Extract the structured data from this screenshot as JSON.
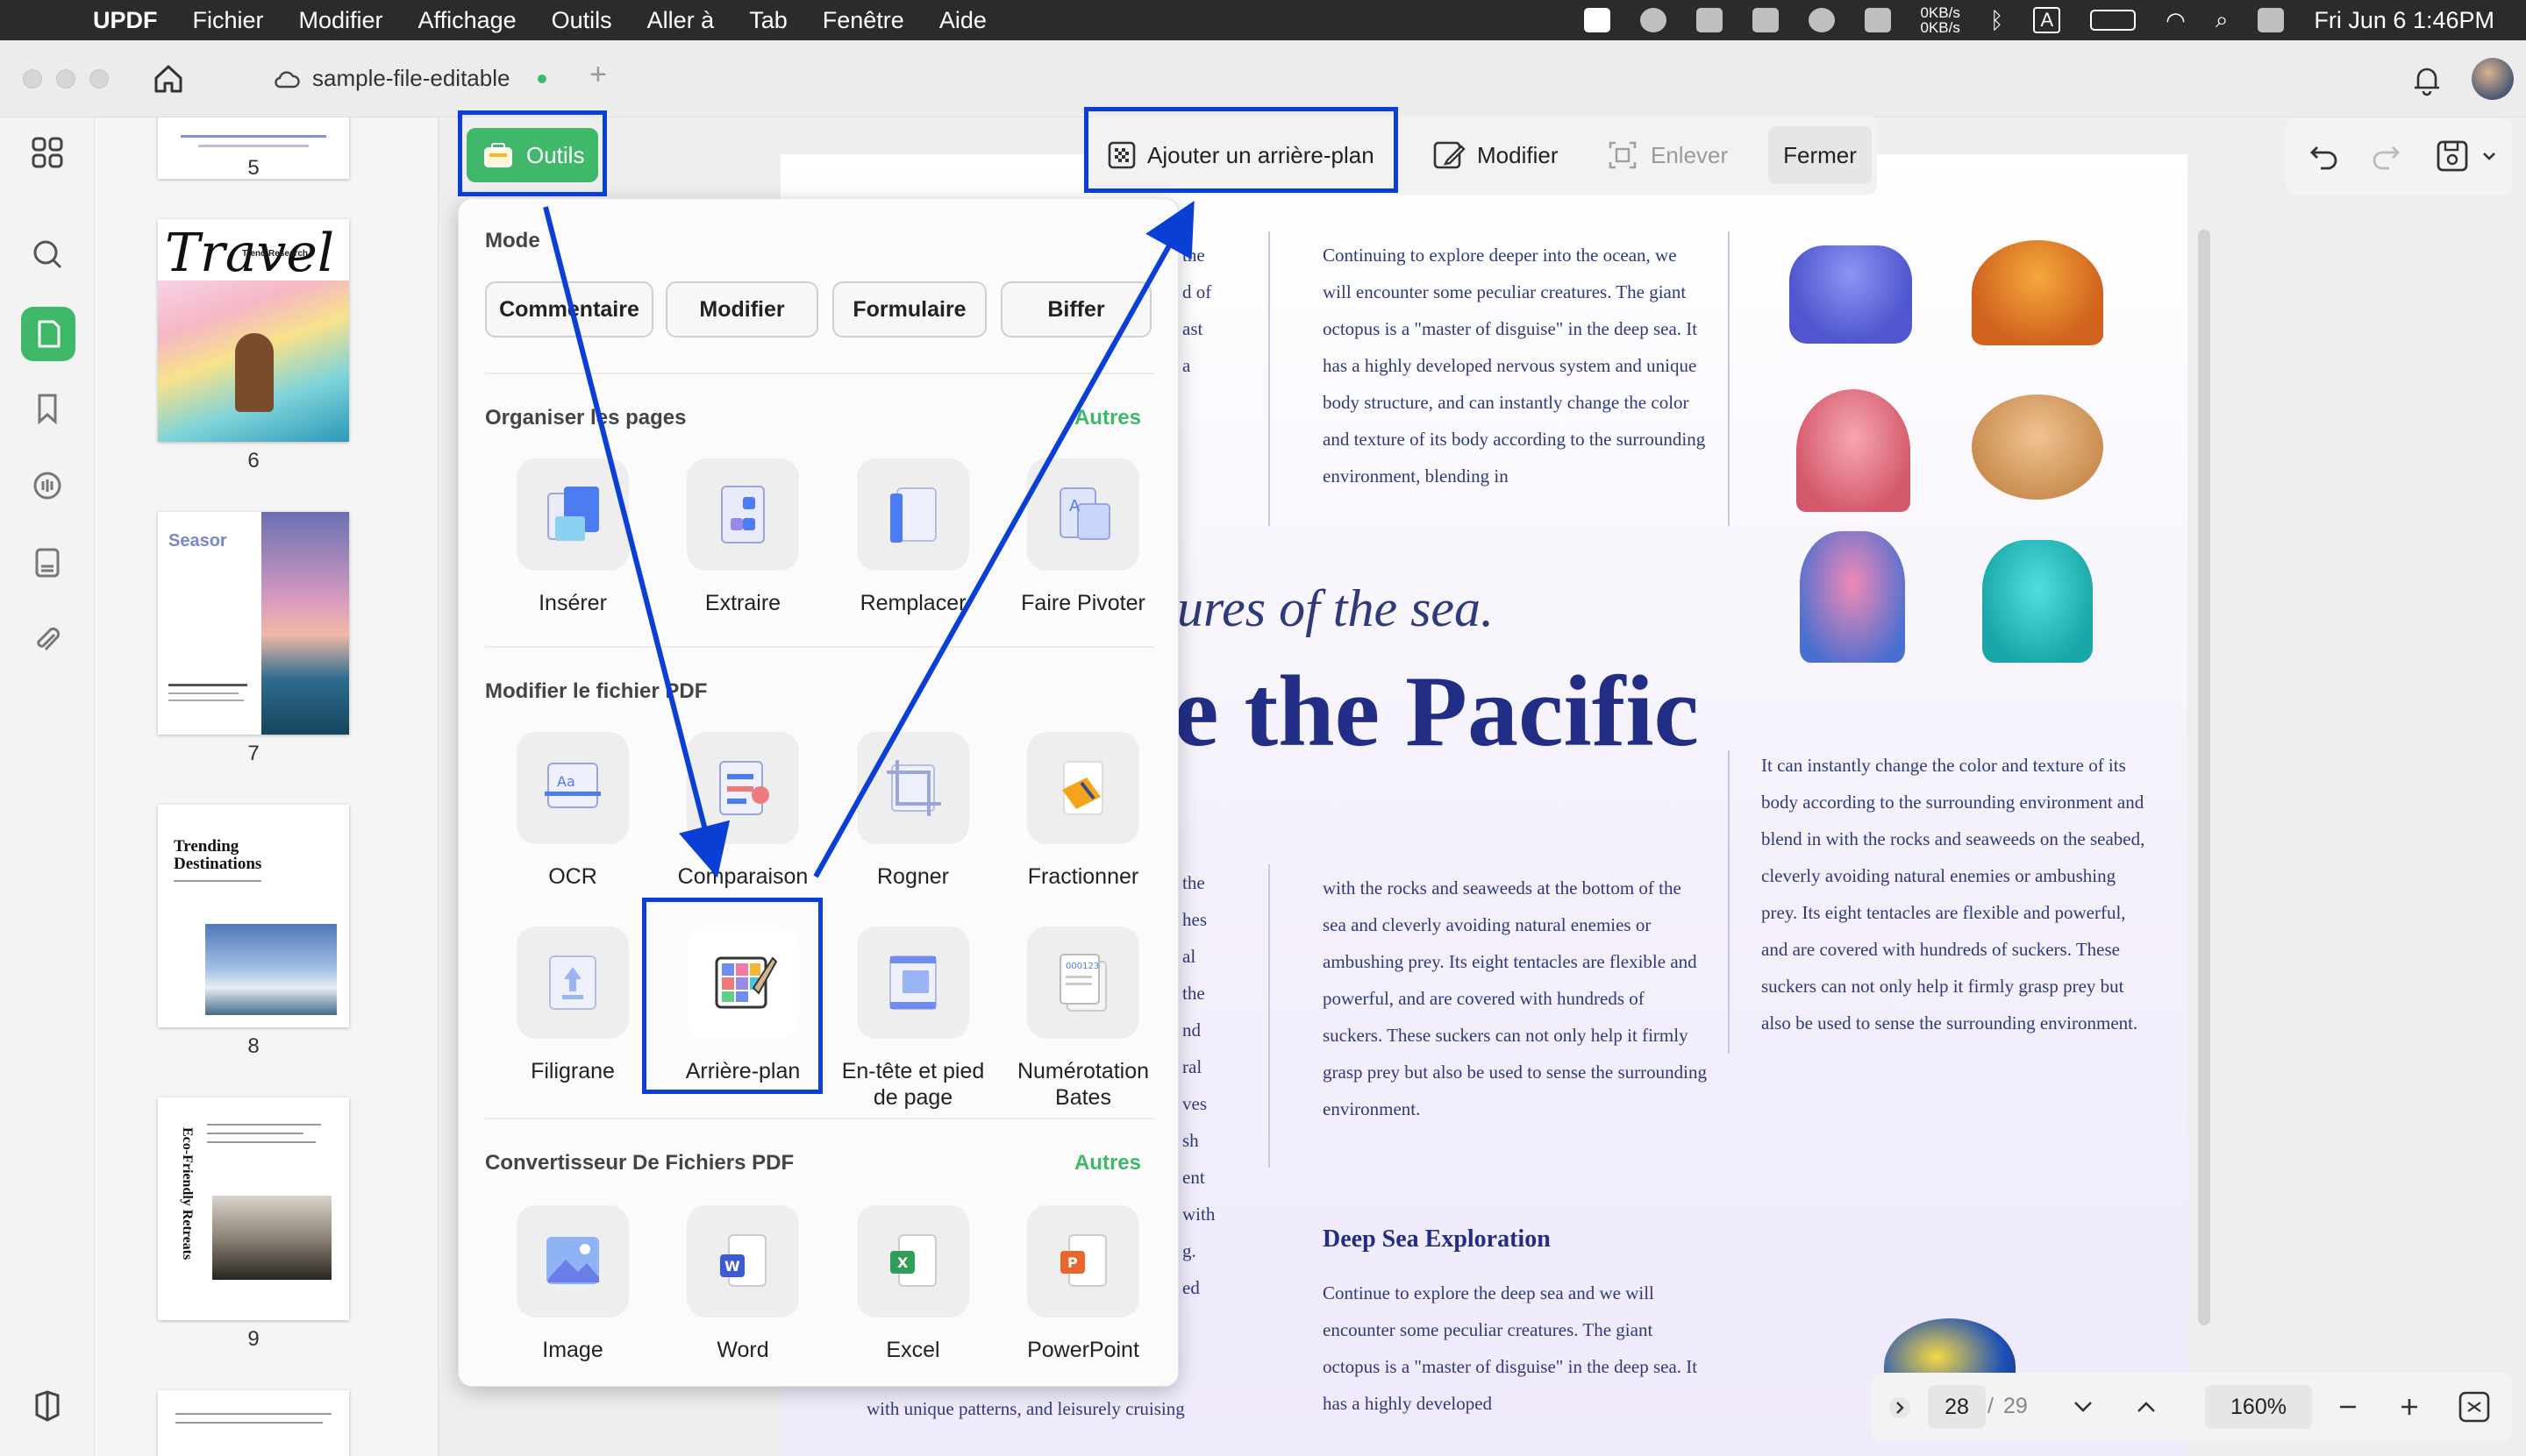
{
  "menubar": {
    "app": "UPDF",
    "items": [
      "Fichier",
      "Modifier",
      "Affichage",
      "Outils",
      "Aller à",
      "Tab",
      "Fenêtre",
      "Aide"
    ],
    "net_up": "0KB/s",
    "net_down": "0KB/s",
    "input_source": "A",
    "datetime": "Fri Jun 6  1:46PM"
  },
  "tab": {
    "title": "sample-file-editable"
  },
  "thumbnails": {
    "pages": [
      "5",
      "6",
      "7",
      "8",
      "9"
    ],
    "p6_title": "Travel",
    "p6_sub": "Trend Research",
    "p7_title": "Seasor",
    "p8_title": "Trending Destinations",
    "p9_title": "Eco-Friendly Retreats"
  },
  "outils_button": "Outils",
  "background_toolbar": {
    "add": "Ajouter un arrière-plan",
    "edit": "Modifier",
    "remove": "Enlever",
    "close": "Fermer"
  },
  "tools_panel": {
    "mode_title": "Mode",
    "modes": [
      "Commentaire",
      "Modifier",
      "Formulaire",
      "Biffer"
    ],
    "organize_title": "Organiser les pages",
    "organize_more": "Autres",
    "organize": [
      "Insérer",
      "Extraire",
      "Remplacer",
      "Faire Pivoter"
    ],
    "modify_title": "Modifier le fichier PDF",
    "modify": [
      "OCR",
      "Comparaison",
      "Rogner",
      "Fractionner",
      "Filigrane",
      "Arrière-plan",
      "En-tête et pied de page",
      "Numérotation Bates"
    ],
    "convert_title": "Convertisseur De Fichiers PDF",
    "convert_more": "Autres",
    "convert": [
      "Image",
      "Word",
      "Excel",
      "PowerPoint"
    ]
  },
  "document": {
    "col2_top": "Continuing to explore deeper into the ocean, we will encounter some peculiar creatures. The giant octopus is a \"master of disguise\" in the deep sea. It has a highly developed nervous system and unique body structure, and can instantly change the color and texture of its body according to the surrounding environment, blending in",
    "partial_left_top": [
      "the",
      "d of",
      "ast",
      "",
      "",
      "a"
    ],
    "headline_italic": "ures of the sea.",
    "headline_bold": "e the Pacific",
    "col3_text": "It can instantly change the color and texture of its body according to the surrounding environment and blend in with the rocks and seaweeds on the seabed, cleverly avoiding natural enemies or ambushing prey. Its eight tentacles are flexible and powerful, and are covered with hundreds of suckers. These suckers can not only help it firmly grasp prey but also be used to sense the surrounding environment.",
    "col2_mid": "with the rocks and seaweeds at the bottom of the sea and cleverly avoiding natural enemies or ambushing prey. Its eight tentacles are flexible and powerful, and are covered with hundreds of suckers. These suckers can not only help it firmly grasp prey but also be used to sense the surrounding environment.",
    "partial_left_mid": [
      "the",
      "hes",
      "al",
      "the",
      "nd",
      "ral",
      "ves",
      "",
      "sh",
      "ent",
      "with",
      "",
      "g.",
      "ed"
    ],
    "partial_left_bottom": "with unique patterns, and leisurely cruising",
    "section_title": "Deep Sea Exploration",
    "col2_bottom": "Continue to explore the deep sea and we will encounter some peculiar creatures. The giant octopus is a \"master of disguise\" in the deep sea. It has a highly developed"
  },
  "pagenav": {
    "current": "28",
    "separator": "/",
    "total": "29",
    "zoom": "160%"
  },
  "colors": {
    "accent": "#3fb86a",
    "highlight": "#0a3fd6",
    "doc_text": "#2f3a7a"
  }
}
